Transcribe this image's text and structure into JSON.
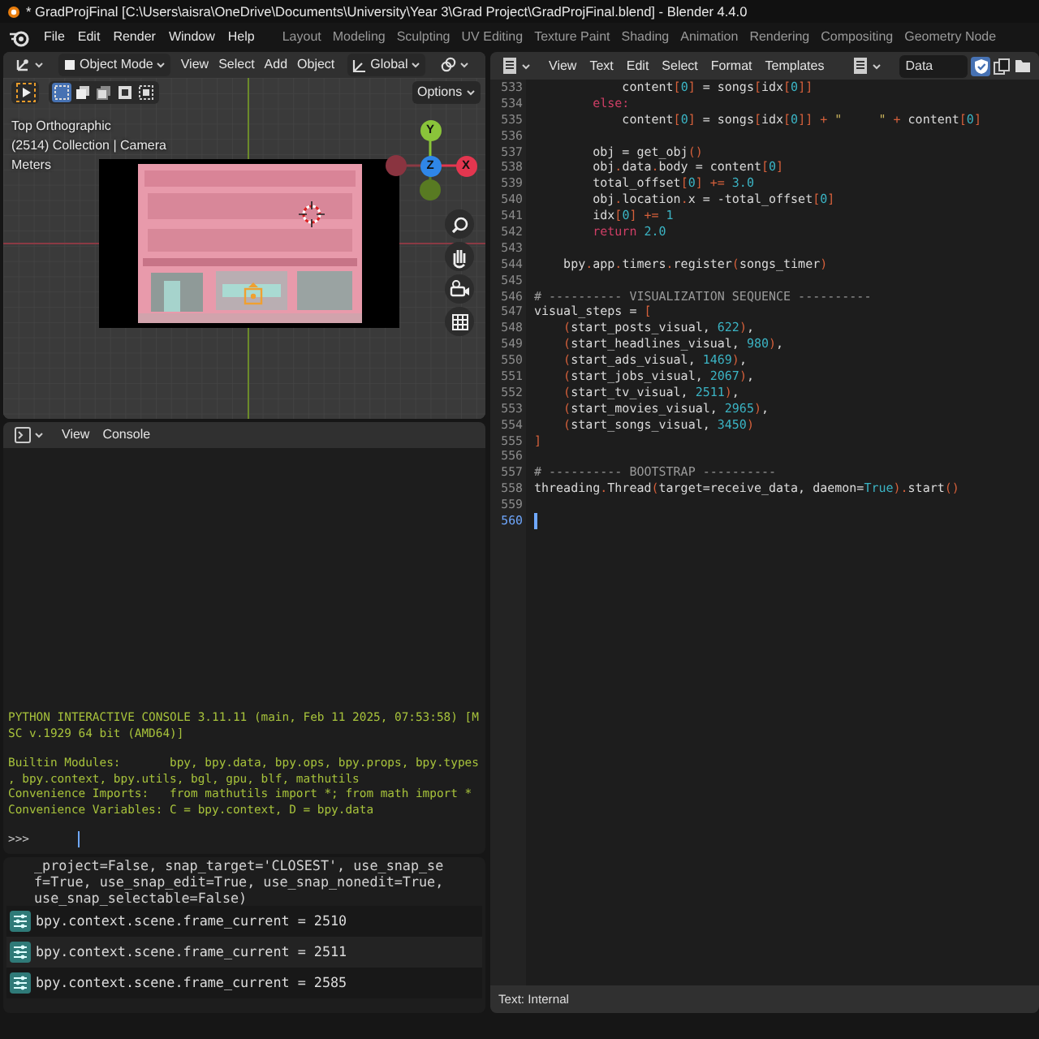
{
  "window": {
    "title": "* GradProjFinal [C:\\Users\\aisra\\OneDrive\\Documents\\University\\Year 3\\Grad Project\\GradProjFinal.blend] - Blender 4.4.0"
  },
  "menu": [
    "File",
    "Edit",
    "Render",
    "Window",
    "Help"
  ],
  "workspaces": [
    {
      "label": "Layout",
      "selected": false
    },
    {
      "label": "Modeling",
      "selected": false
    },
    {
      "label": "Sculpting",
      "selected": false
    },
    {
      "label": "UV Editing",
      "selected": false
    },
    {
      "label": "Texture Paint",
      "selected": false
    },
    {
      "label": "Shading",
      "selected": false
    },
    {
      "label": "Animation",
      "selected": false
    },
    {
      "label": "Rendering",
      "selected": false
    },
    {
      "label": "Compositing",
      "selected": false
    },
    {
      "label": "Geometry Node",
      "selected": false
    }
  ],
  "viewport": {
    "mode": "Object Mode",
    "menus": [
      "View",
      "Select",
      "Add",
      "Object"
    ],
    "orientation": "Global",
    "options": "Options",
    "select_modes": [
      {
        "selected": true
      },
      {
        "selected": false
      },
      {
        "selected": false
      },
      {
        "selected": false
      },
      {
        "selected": false
      }
    ],
    "overlay_lines": [
      "Top Orthographic",
      "(2514) Collection | Camera",
      "Meters"
    ],
    "gizmo_axes": [
      {
        "label": "Y",
        "color": "#8ac43a"
      },
      {
        "label": "Z",
        "color": "#2f86e8"
      },
      {
        "label": "X",
        "color": "#e3364f"
      }
    ]
  },
  "console": {
    "menus": [
      "View",
      "Console"
    ],
    "lines": [
      "PYTHON INTERACTIVE CONSOLE 3.11.11 (main, Feb 11 2025, 07:53:58) [M",
      "SC v.1929 64 bit (AMD64)]",
      "Builtin Modules:       bpy, bpy.data, bpy.ops, bpy.props, bpy.types",
      ", bpy.context, bpy.utils, bgl, gpu, blf, mathutils",
      "Convenience Imports:   from mathutils import *; from math import *",
      "Convenience Variables: C = bpy.context, D = bpy.data"
    ],
    "prompt": ">>>"
  },
  "reports": {
    "wrapped_lines": [
      "_project=False, snap_target='CLOSEST', use_snap_se",
      "f=True, use_snap_edit=True, use_snap_nonedit=True,",
      "use_snap_selectable=False)"
    ],
    "items": [
      "bpy.context.scene.frame_current = 2510",
      "bpy.context.scene.frame_current = 2511",
      "bpy.context.scene.frame_current = 2585"
    ]
  },
  "text_editor": {
    "menus": [
      "View",
      "Text",
      "Edit",
      "Select",
      "Format",
      "Templates"
    ],
    "datablock": "Data",
    "fake_user": true,
    "footer": "Text: Internal",
    "lines": [
      {
        "number": "533",
        "current": false,
        "tokens": [
          {
            "kind": "text",
            "text": "            content"
          },
          {
            "kind": "op",
            "text": "["
          },
          {
            "kind": "num",
            "text": "0"
          },
          {
            "kind": "op",
            "text": "]"
          },
          {
            "kind": "text",
            "text": " = songs"
          },
          {
            "kind": "op",
            "text": "["
          },
          {
            "kind": "text",
            "text": "idx"
          },
          {
            "kind": "op",
            "text": "["
          },
          {
            "kind": "num",
            "text": "0"
          },
          {
            "kind": "op",
            "text": "]]"
          }
        ]
      },
      {
        "number": "534",
        "current": false,
        "tokens": [
          {
            "kind": "keyword",
            "text": "        else:"
          }
        ]
      },
      {
        "number": "535",
        "current": false,
        "tokens": [
          {
            "kind": "text",
            "text": "            content"
          },
          {
            "kind": "op",
            "text": "["
          },
          {
            "kind": "num",
            "text": "0"
          },
          {
            "kind": "op",
            "text": "]"
          },
          {
            "kind": "text",
            "text": " = songs"
          },
          {
            "kind": "op",
            "text": "["
          },
          {
            "kind": "text",
            "text": "idx"
          },
          {
            "kind": "op",
            "text": "["
          },
          {
            "kind": "num",
            "text": "0"
          },
          {
            "kind": "op",
            "text": "]] +"
          },
          {
            "kind": "string",
            "text": " \"     \""
          },
          {
            "kind": "op",
            "text": " +"
          },
          {
            "kind": "text",
            "text": " content"
          },
          {
            "kind": "op",
            "text": "["
          },
          {
            "kind": "num",
            "text": "0"
          },
          {
            "kind": "op",
            "text": "]"
          }
        ]
      },
      {
        "number": "536",
        "current": false
      },
      {
        "number": "537",
        "current": false,
        "tokens": [
          {
            "kind": "text",
            "text": "        obj = get_obj"
          },
          {
            "kind": "op",
            "text": "()"
          }
        ]
      },
      {
        "number": "538",
        "current": false,
        "tokens": [
          {
            "kind": "text",
            "text": "        obj"
          },
          {
            "kind": "op",
            "text": "."
          },
          {
            "kind": "text",
            "text": "data"
          },
          {
            "kind": "op",
            "text": "."
          },
          {
            "kind": "text",
            "text": "body = content"
          },
          {
            "kind": "op",
            "text": "["
          },
          {
            "kind": "num",
            "text": "0"
          },
          {
            "kind": "op",
            "text": "]"
          }
        ]
      },
      {
        "number": "539",
        "current": false,
        "tokens": [
          {
            "kind": "text",
            "text": "        total_offset"
          },
          {
            "kind": "op",
            "text": "["
          },
          {
            "kind": "num",
            "text": "0"
          },
          {
            "kind": "op",
            "text": "] +="
          },
          {
            "kind": "num",
            "text": " 3.0"
          }
        ]
      },
      {
        "number": "540",
        "current": false,
        "tokens": [
          {
            "kind": "text",
            "text": "        obj"
          },
          {
            "kind": "op",
            "text": "."
          },
          {
            "kind": "text",
            "text": "location"
          },
          {
            "kind": "op",
            "text": "."
          },
          {
            "kind": "text",
            "text": "x = -total_offset"
          },
          {
            "kind": "op",
            "text": "["
          },
          {
            "kind": "num",
            "text": "0"
          },
          {
            "kind": "op",
            "text": "]"
          }
        ]
      },
      {
        "number": "541",
        "current": false,
        "tokens": [
          {
            "kind": "text",
            "text": "        idx"
          },
          {
            "kind": "op",
            "text": "["
          },
          {
            "kind": "num",
            "text": "0"
          },
          {
            "kind": "op",
            "text": "] +="
          },
          {
            "kind": "num",
            "text": " 1"
          }
        ]
      },
      {
        "number": "542",
        "current": false,
        "tokens": [
          {
            "kind": "keyword",
            "text": "        return"
          },
          {
            "kind": "num",
            "text": " 2.0"
          }
        ]
      },
      {
        "number": "543",
        "current": false
      },
      {
        "number": "544",
        "current": false,
        "tokens": [
          {
            "kind": "text",
            "text": "    bpy"
          },
          {
            "kind": "op",
            "text": "."
          },
          {
            "kind": "text",
            "text": "app"
          },
          {
            "kind": "op",
            "text": "."
          },
          {
            "kind": "text",
            "text": "timers"
          },
          {
            "kind": "op",
            "text": "."
          },
          {
            "kind": "text",
            "text": "register"
          },
          {
            "kind": "op",
            "text": "("
          },
          {
            "kind": "text",
            "text": "songs_timer"
          },
          {
            "kind": "op",
            "text": ")"
          }
        ]
      },
      {
        "number": "545",
        "current": false
      },
      {
        "number": "546",
        "current": false,
        "tokens": [
          {
            "kind": "comment",
            "text": "# ---------- VISUALIZATION SEQUENCE ----------"
          }
        ]
      },
      {
        "number": "547",
        "current": false,
        "tokens": [
          {
            "kind": "text",
            "text": "visual_steps = "
          },
          {
            "kind": "op",
            "text": "["
          }
        ]
      },
      {
        "number": "548",
        "current": false,
        "tokens": [
          {
            "kind": "op",
            "text": "    ("
          },
          {
            "kind": "text",
            "text": "start_posts_visual, "
          },
          {
            "kind": "num",
            "text": "622"
          },
          {
            "kind": "op",
            "text": ")"
          },
          {
            "kind": "text",
            "text": ","
          }
        ]
      },
      {
        "number": "549",
        "current": false,
        "tokens": [
          {
            "kind": "op",
            "text": "    ("
          },
          {
            "kind": "text",
            "text": "start_headlines_visual, "
          },
          {
            "kind": "num",
            "text": "980"
          },
          {
            "kind": "op",
            "text": ")"
          },
          {
            "kind": "text",
            "text": ","
          }
        ]
      },
      {
        "number": "550",
        "current": false,
        "tokens": [
          {
            "kind": "op",
            "text": "    ("
          },
          {
            "kind": "text",
            "text": "start_ads_visual, "
          },
          {
            "kind": "num",
            "text": "1469"
          },
          {
            "kind": "op",
            "text": ")"
          },
          {
            "kind": "text",
            "text": ","
          }
        ]
      },
      {
        "number": "551",
        "current": false,
        "tokens": [
          {
            "kind": "op",
            "text": "    ("
          },
          {
            "kind": "text",
            "text": "start_jobs_visual, "
          },
          {
            "kind": "num",
            "text": "2067"
          },
          {
            "kind": "op",
            "text": ")"
          },
          {
            "kind": "text",
            "text": ","
          }
        ]
      },
      {
        "number": "552",
        "current": false,
        "tokens": [
          {
            "kind": "op",
            "text": "    ("
          },
          {
            "kind": "text",
            "text": "start_tv_visual, "
          },
          {
            "kind": "num",
            "text": "2511"
          },
          {
            "kind": "op",
            "text": ")"
          },
          {
            "kind": "text",
            "text": ","
          }
        ]
      },
      {
        "number": "553",
        "current": false,
        "tokens": [
          {
            "kind": "op",
            "text": "    ("
          },
          {
            "kind": "text",
            "text": "start_movies_visual, "
          },
          {
            "kind": "num",
            "text": "2965"
          },
          {
            "kind": "op",
            "text": ")"
          },
          {
            "kind": "text",
            "text": ","
          }
        ]
      },
      {
        "number": "554",
        "current": false,
        "tokens": [
          {
            "kind": "op",
            "text": "    ("
          },
          {
            "kind": "text",
            "text": "start_songs_visual, "
          },
          {
            "kind": "num",
            "text": "3450"
          },
          {
            "kind": "op",
            "text": ")"
          }
        ]
      },
      {
        "number": "555",
        "current": false,
        "tokens": [
          {
            "kind": "op",
            "text": "]"
          }
        ]
      },
      {
        "number": "556",
        "current": false
      },
      {
        "number": "557",
        "current": false,
        "tokens": [
          {
            "kind": "comment",
            "text": "# ---------- BOOTSTRAP ----------"
          }
        ]
      },
      {
        "number": "558",
        "current": false,
        "tokens": [
          {
            "kind": "text",
            "text": "threading"
          },
          {
            "kind": "op",
            "text": "."
          },
          {
            "kind": "text",
            "text": "Thread"
          },
          {
            "kind": "op",
            "text": "("
          },
          {
            "kind": "text",
            "text": "target=receive_data, daemon="
          },
          {
            "kind": "num",
            "text": "True"
          },
          {
            "kind": "op",
            "text": ")."
          },
          {
            "kind": "text",
            "text": "start"
          },
          {
            "kind": "op",
            "text": "()"
          }
        ]
      },
      {
        "number": "559",
        "current": false
      },
      {
        "number": "560",
        "current": true
      }
    ]
  }
}
